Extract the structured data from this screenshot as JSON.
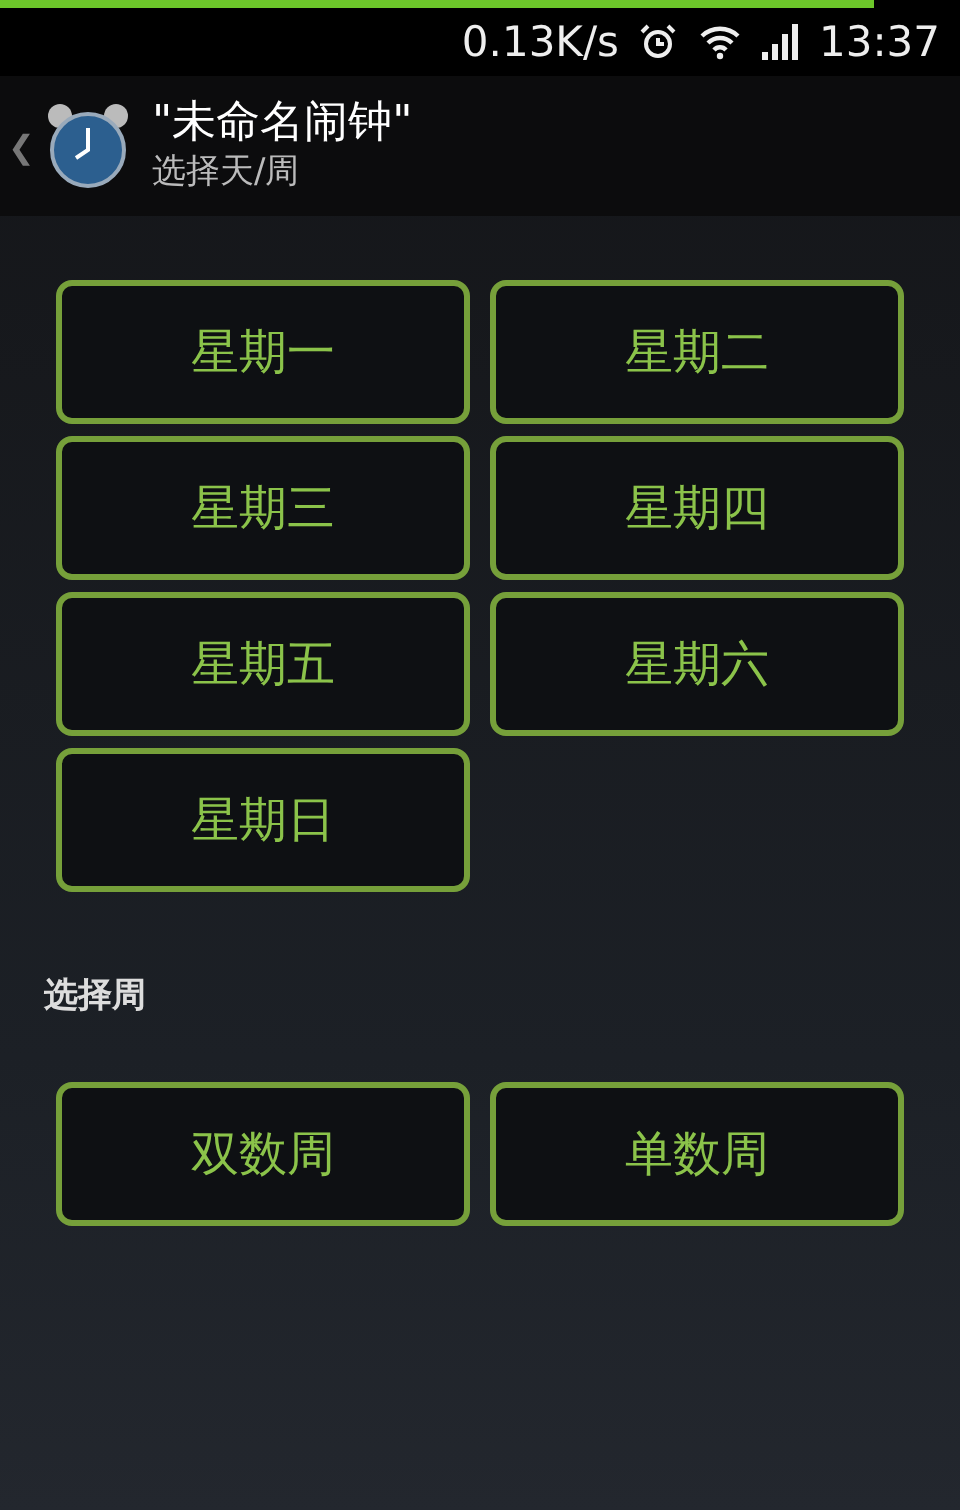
{
  "progress": {
    "level": 0.91
  },
  "status_bar": {
    "speed": "0.13K/s",
    "time": "13:37"
  },
  "header": {
    "back": "❮",
    "title": "\"未命名闹钟\"",
    "subtitle": "选择天/周"
  },
  "days": [
    {
      "label": "星期一",
      "selected": false
    },
    {
      "label": "星期二",
      "selected": false
    },
    {
      "label": "星期三",
      "selected": false
    },
    {
      "label": "星期四",
      "selected": false
    },
    {
      "label": "星期五",
      "selected": false
    },
    {
      "label": "星期六",
      "selected": false
    },
    {
      "label": "星期日",
      "selected": false
    }
  ],
  "week_section": {
    "title": "选择周"
  },
  "weeks": [
    {
      "label": "双数周",
      "selected": false
    },
    {
      "label": "单数周",
      "selected": false
    }
  ]
}
